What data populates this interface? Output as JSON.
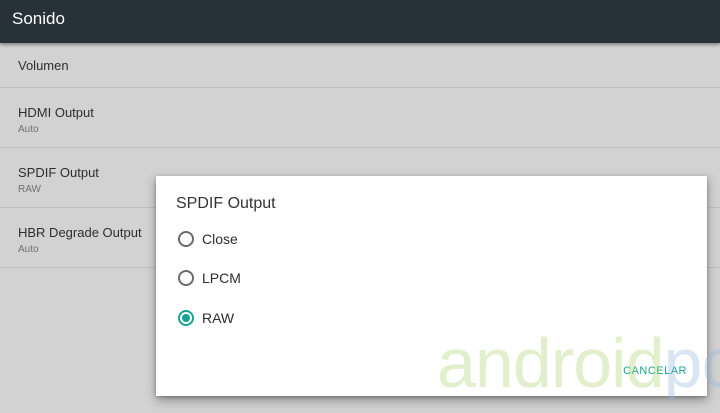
{
  "toolbar": {
    "title": "Sonido"
  },
  "settings": {
    "items": [
      {
        "title": "Volumen",
        "summary": ""
      },
      {
        "title": "HDMI Output",
        "summary": "Auto"
      },
      {
        "title": "SPDIF Output",
        "summary": "RAW"
      },
      {
        "title": "HBR Degrade Output",
        "summary": "Auto"
      }
    ]
  },
  "dialog": {
    "title": "SPDIF Output",
    "options": [
      {
        "label": "Close",
        "selected": false
      },
      {
        "label": "LPCM",
        "selected": false
      },
      {
        "label": "RAW",
        "selected": true
      }
    ],
    "cancel_label": "CANCELAR"
  },
  "watermark": {
    "text_main": "android",
    "text_suffix": "pc"
  },
  "colors": {
    "toolbar": "#263238",
    "accent": "#16a392",
    "background": "#d2d2d2"
  }
}
